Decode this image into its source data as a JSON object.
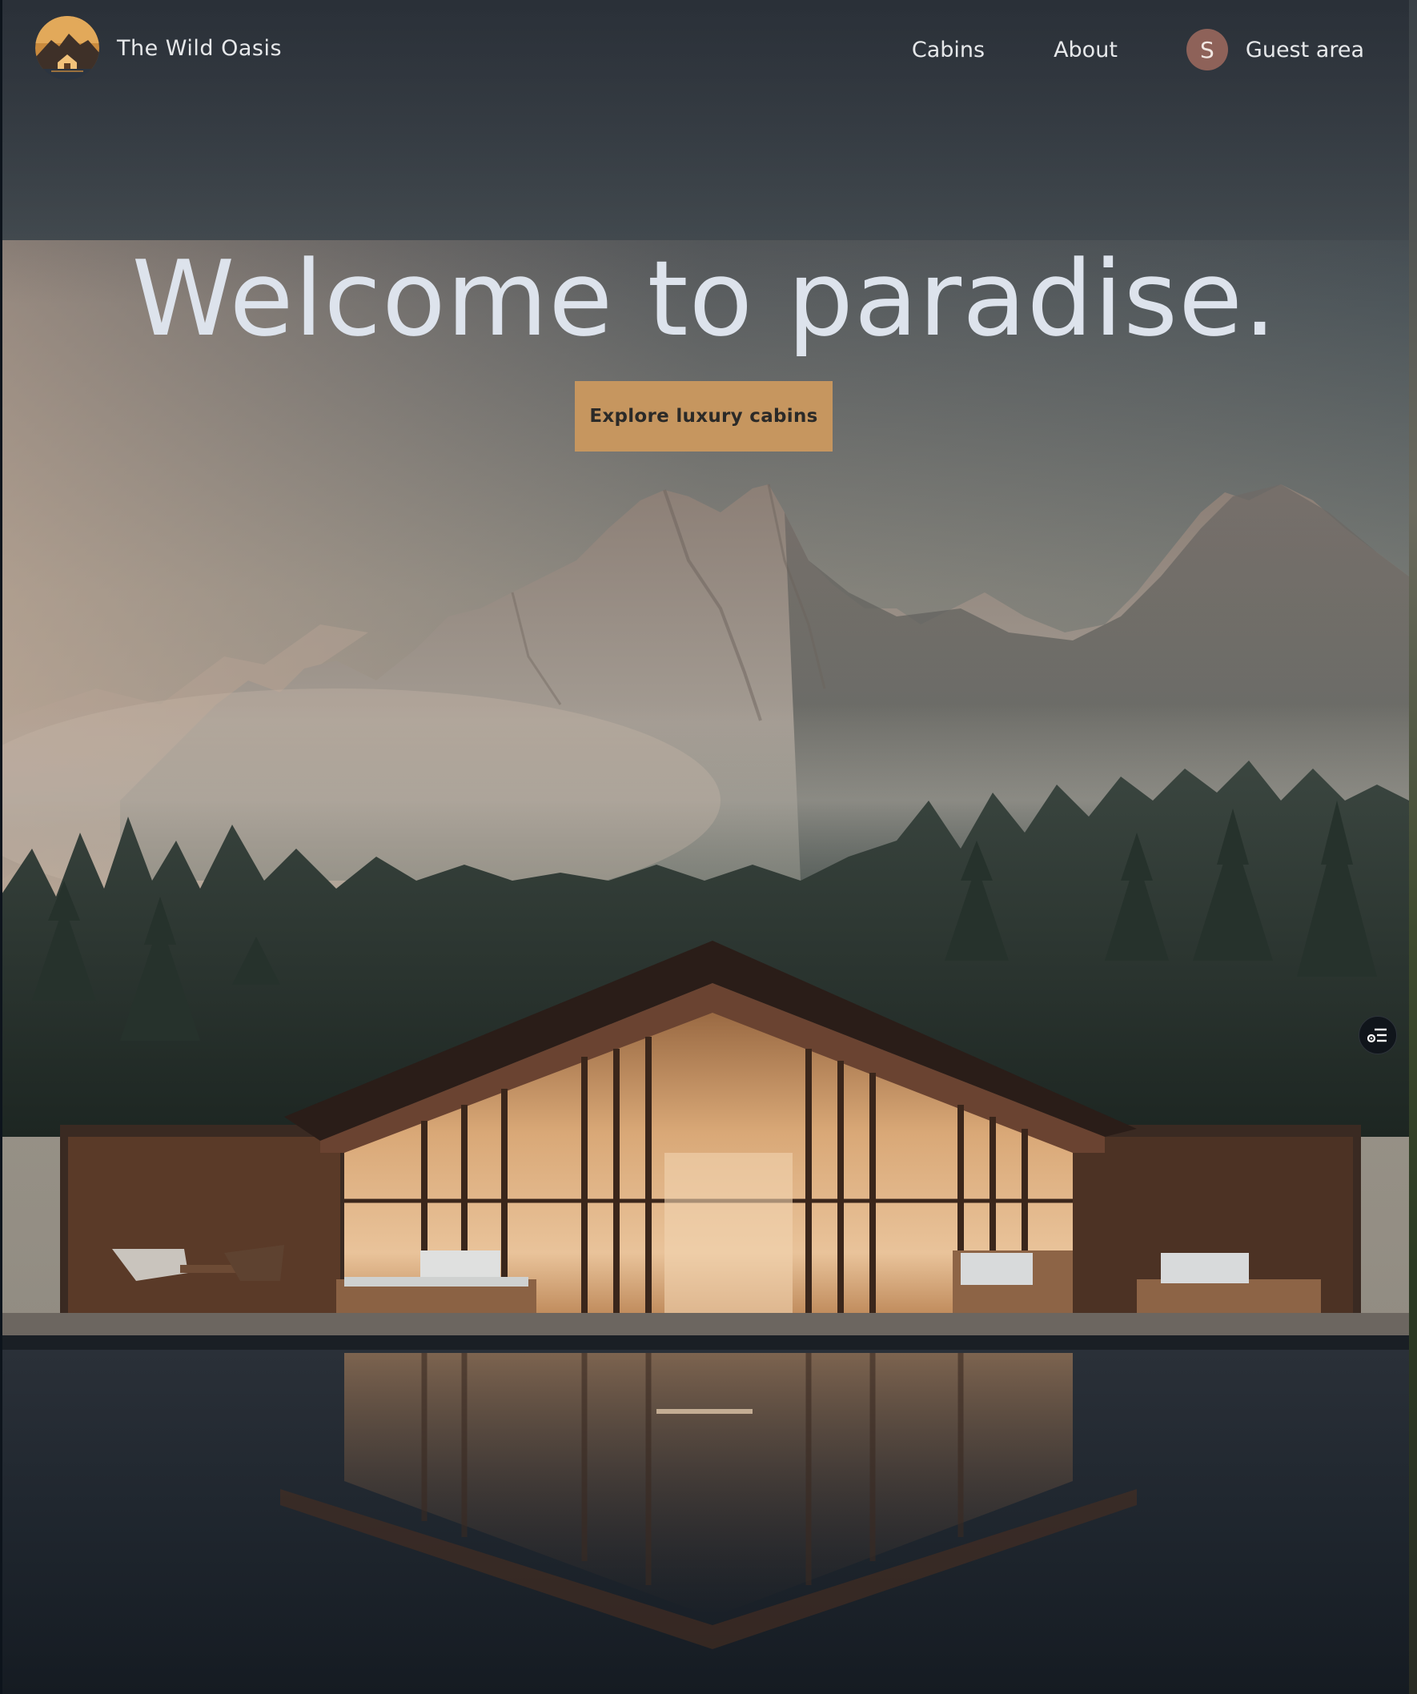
{
  "brand": {
    "name": "The Wild Oasis",
    "logo_icon": "mountain-cabin-logo-icon"
  },
  "nav": {
    "cabins_label": "Cabins",
    "about_label": "About",
    "guest_label": "Guest area",
    "avatar_initial": "S"
  },
  "hero": {
    "title": "Welcome to paradise.",
    "cta_label": "Explore luxury cabins",
    "background": "mountain-lake-cabin-photo"
  },
  "floating_button_icon": "list-settings-icon",
  "colors": {
    "accent": "#c6965f",
    "avatar_bg": "#8e6259",
    "text": "#e6e8ea",
    "title": "#dde3ec"
  }
}
